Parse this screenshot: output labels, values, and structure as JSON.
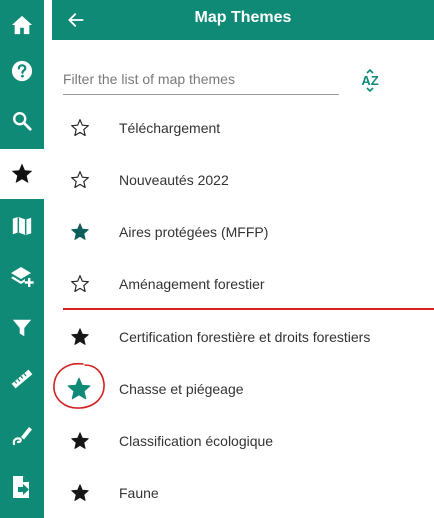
{
  "header": {
    "title": "Map Themes",
    "back_icon": "arrow-left-icon"
  },
  "filter": {
    "value": "",
    "placeholder": "Filter the list of map themes"
  },
  "sort_button": {
    "label": "AZ",
    "icon": "sort-alpha-icon"
  },
  "rail": {
    "items": [
      {
        "name": "home",
        "icon": "home-icon"
      },
      {
        "name": "help",
        "icon": "help-icon"
      },
      {
        "name": "search",
        "icon": "search-icon"
      },
      {
        "name": "favorites",
        "icon": "star-icon",
        "active": true
      },
      {
        "name": "map",
        "icon": "map-icon"
      },
      {
        "name": "add-layer",
        "icon": "layers-add-icon"
      },
      {
        "name": "filter",
        "icon": "filter-icon"
      },
      {
        "name": "measure",
        "icon": "ruler-icon"
      },
      {
        "name": "draw",
        "icon": "draw-icon"
      },
      {
        "name": "export",
        "icon": "file-export-icon"
      }
    ]
  },
  "themes": [
    {
      "label": "Téléchargement",
      "star": "outline"
    },
    {
      "label": "Nouveautés 2022",
      "star": "outline"
    },
    {
      "label": "Aires protégées (MFFP)",
      "star": "filled-teal"
    },
    {
      "label": "Aménagement forestier",
      "star": "outline"
    },
    {
      "label": "Certification forestière et droits forestiers",
      "star": "filled-black"
    },
    {
      "label": "Chasse et piégeage",
      "star": "filled-teal"
    },
    {
      "label": "Classification écologique",
      "star": "filled-black"
    },
    {
      "label": "Faune",
      "star": "filled-black"
    }
  ],
  "colors": {
    "brand": "#0e8a76",
    "star_teal": "#0e8a76",
    "star_dark_teal": "#0d5e5a",
    "annotation_red": "#d42020"
  }
}
